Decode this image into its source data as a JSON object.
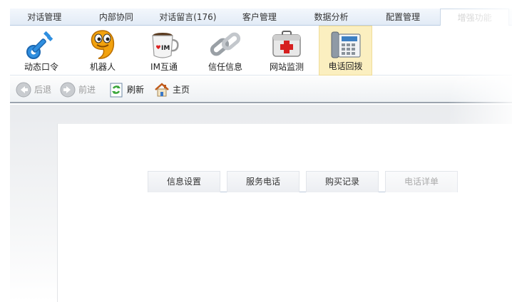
{
  "menu": {
    "tabs": [
      {
        "label": "对话管理"
      },
      {
        "label": "内部协同"
      },
      {
        "label": "对话留言(176)"
      },
      {
        "label": "客户管理"
      },
      {
        "label": "数据分析"
      },
      {
        "label": "配置管理"
      },
      {
        "label": "增强功能"
      }
    ],
    "active_index": 6
  },
  "toolbar": {
    "items": [
      {
        "label": "动态口令",
        "icon": "key-icon"
      },
      {
        "label": "机器人",
        "icon": "robot-icon"
      },
      {
        "label": "IM互通",
        "icon": "im-cup-icon"
      },
      {
        "label": "信任信息",
        "icon": "chain-link-icon"
      },
      {
        "label": "网站监测",
        "icon": "first-aid-kit-icon"
      },
      {
        "label": "电话回拨",
        "icon": "phone-icon"
      }
    ],
    "selected_index": 5
  },
  "nav": {
    "back_label": "后退",
    "forward_label": "前进",
    "refresh_label": "刷新",
    "home_label": "主页"
  },
  "subtabs": {
    "items": [
      {
        "label": "信息设置"
      },
      {
        "label": "服务电话"
      },
      {
        "label": "购买记录"
      },
      {
        "label": "电话详单"
      }
    ]
  },
  "colors": {
    "accent_blue": "#2f8fe0",
    "selected_bg": "#fbefc0",
    "refresh_green": "#3aa63a"
  }
}
